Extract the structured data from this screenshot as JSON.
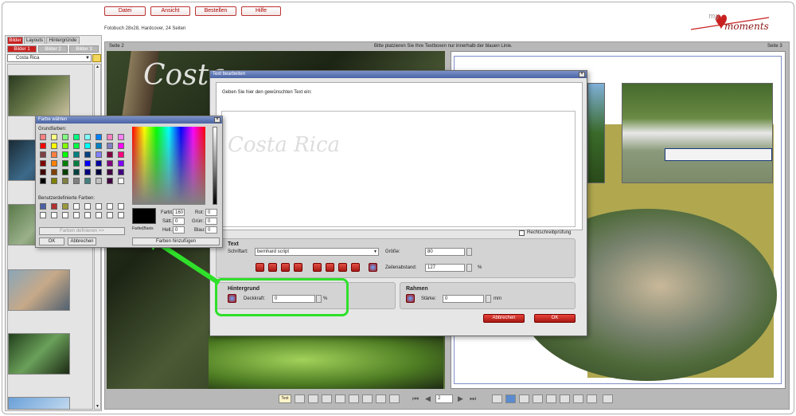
{
  "menu": {
    "file": "Datei",
    "view": "Ansicht",
    "order": "Bestellen",
    "help": "Hilfe"
  },
  "book_info": "Fotobuch 28x28, Hardcover, 24 Seiten",
  "logo": {
    "text_my": "my",
    "text_moments": "moments",
    "accent": "#c8201f"
  },
  "left_panel": {
    "tabs": [
      "Bilder",
      "Layouts",
      "Hintergründe"
    ],
    "subtabs": [
      "Bilder 1",
      "Bilder 2",
      "Bilder 3"
    ],
    "folder": "Costa Rica"
  },
  "workspace": {
    "left_page_label": "Seite 2",
    "hint": "Bitte platzieren Sie Ihre Textboxen nur innerhalb der blauen Linie.",
    "right_page_label": "Seite 3",
    "page_title_text": "Costa"
  },
  "text_dialog": {
    "title": "Text bearbeiten",
    "prompt": "Geben Sie hier den gewünschten Text ein:",
    "preview_text": "Costa Rica",
    "spellcheck": "Rechtschreibprüfung",
    "text_section": {
      "heading": "Text",
      "font_label": "Schriftart:",
      "font_value": "bernhard script",
      "size_label": "Größe:",
      "size_value": "80",
      "line_spacing_label": "Zeilenabstand:",
      "line_spacing_value": "127",
      "line_spacing_unit": "%"
    },
    "background_section": {
      "heading": "Hintergrund",
      "opacity_label": "Deckkraft:",
      "opacity_value": "0",
      "unit": "%"
    },
    "frame_section": {
      "heading": "Rahmen",
      "strength_label": "Stärke:",
      "strength_value": "0",
      "unit": "mm"
    },
    "cancel": "Abbrechen",
    "ok": "OK"
  },
  "color_dialog": {
    "title": "Farbe wählen",
    "basic_colors_label": "Grundfarben:",
    "custom_colors_label": "Benutzerdefinierte Farben:",
    "define_button": "Farben definieren >>",
    "ok": "OK",
    "cancel": "Abbrechen",
    "add_button": "Farben hinzufügen",
    "color_solid_label": "Farbe|Basis",
    "hue_label": "Farbt.:",
    "hue_value": "160",
    "sat_label": "Sätt.:",
    "sat_value": "0",
    "lum_label": "Hell.:",
    "lum_value": "0",
    "red_label": "Rot:",
    "red_value": "0",
    "green_label": "Grün:",
    "green_value": "0",
    "blue_label": "Blau:",
    "blue_value": "0",
    "basic_colors": [
      "#ff8080",
      "#ffff80",
      "#80ff80",
      "#00ff80",
      "#80ffff",
      "#0080ff",
      "#ff80c0",
      "#ff80ff",
      "#ff0000",
      "#ffff00",
      "#80ff00",
      "#00ff40",
      "#00ffff",
      "#0080c0",
      "#8080c0",
      "#ff00ff",
      "#804040",
      "#ff8040",
      "#00ff00",
      "#008080",
      "#004080",
      "#8080ff",
      "#800040",
      "#ff0080",
      "#800000",
      "#ff8000",
      "#008000",
      "#008040",
      "#0000ff",
      "#0000a0",
      "#800080",
      "#8000ff",
      "#400000",
      "#804000",
      "#004000",
      "#004040",
      "#000080",
      "#000040",
      "#400040",
      "#400080",
      "#000000",
      "#808000",
      "#808040",
      "#808080",
      "#408080",
      "#c0c0c0",
      "#400040",
      "#ffffff"
    ],
    "custom_colors": [
      "#4a5fa6",
      "#b23030",
      "#9a9a3a",
      "#ffffff",
      "#ffffff",
      "#ffffff",
      "#ffffff",
      "#ffffff",
      "#ffffff",
      "#ffffff",
      "#ffffff",
      "#ffffff",
      "#ffffff",
      "#ffffff",
      "#ffffff",
      "#ffffff"
    ]
  },
  "bottom_toolbar": {
    "text_button": "Text",
    "page_number": "2"
  }
}
